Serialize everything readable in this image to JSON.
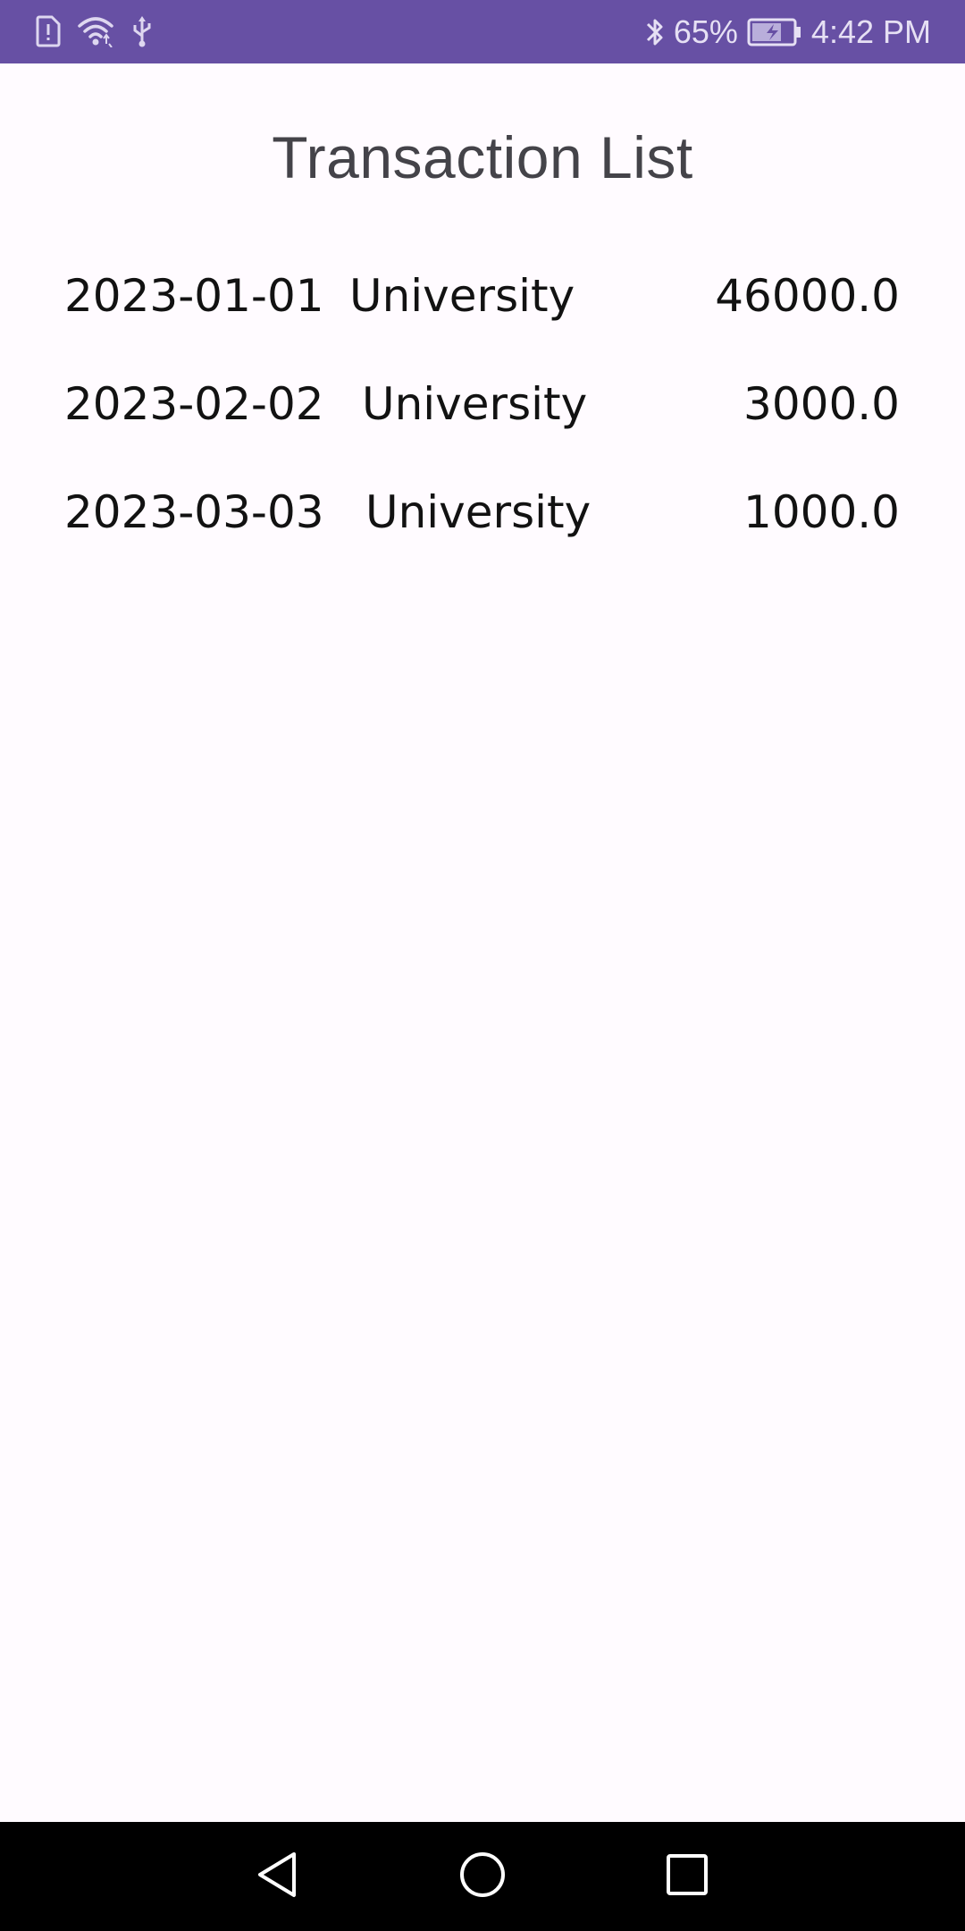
{
  "status_bar": {
    "battery_percent": "65%",
    "time": "4:42 PM",
    "left_icons": [
      "sim-alert-icon",
      "wifi-icon",
      "usb-icon"
    ],
    "right_icons": [
      "bluetooth-icon",
      "battery-charging-icon"
    ]
  },
  "page": {
    "title": "Transaction List"
  },
  "transactions": [
    {
      "date": "2023-01-01",
      "description": "University",
      "amount": "46000.0"
    },
    {
      "date": "2023-02-02",
      "description": "University",
      "amount": "3000.0"
    },
    {
      "date": "2023-03-03",
      "description": "University",
      "amount": "1000.0"
    }
  ],
  "nav_bar": {
    "icons": [
      "back-icon",
      "home-icon",
      "recents-icon"
    ]
  },
  "colors": {
    "status_bar_bg": "#6750a4",
    "background": "#fffbff",
    "title_text": "#444349",
    "row_text": "#121212",
    "nav_bar_bg": "#000000"
  }
}
